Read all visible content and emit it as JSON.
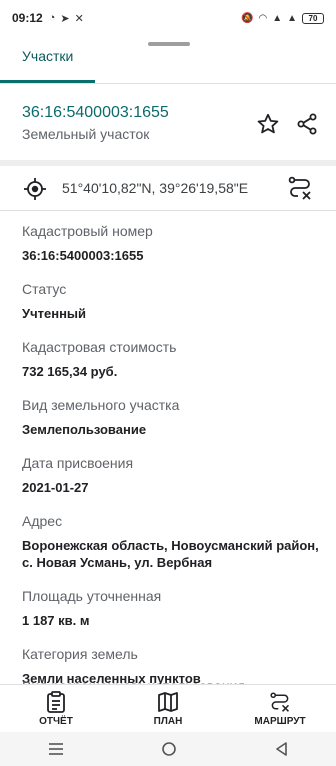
{
  "status_bar": {
    "time": "09:12",
    "battery": "70"
  },
  "tabs": [
    {
      "label": "Участки"
    }
  ],
  "parcel": {
    "cadastral_number": "36:16:5400003:1655",
    "type": "Земельный участок"
  },
  "coordinates": "51°40'10,82\"N, 39°26'19,58\"E",
  "properties": [
    {
      "label": "Кадастровый номер",
      "value": "36:16:5400003:1655"
    },
    {
      "label": "Статус",
      "value": "Учтенный"
    },
    {
      "label": "Кадастровая стоимость",
      "value": "732 165,34 руб."
    },
    {
      "label": "Вид земельного участка",
      "value": "Землепользование"
    },
    {
      "label": "Дата присвоения",
      "value": "2021-01-27"
    },
    {
      "label": "Адрес",
      "value": "Воронежская область, Новоусманский район, с. Новая Усмань, ул. Вербная"
    },
    {
      "label": "Площадь уточненная",
      "value": "1 187 кв. м"
    },
    {
      "label": "Категория земель",
      "value": "Земли населенных пунктов"
    }
  ],
  "cutoff_label": "Вид разрешенного использования",
  "bottom_nav": [
    {
      "label": "ОТЧЁТ",
      "icon": "report-icon"
    },
    {
      "label": "ПЛАН",
      "icon": "map-icon"
    },
    {
      "label": "МАРШРУТ",
      "icon": "route-icon"
    }
  ],
  "colors": {
    "accent": "#0b6a6a"
  }
}
